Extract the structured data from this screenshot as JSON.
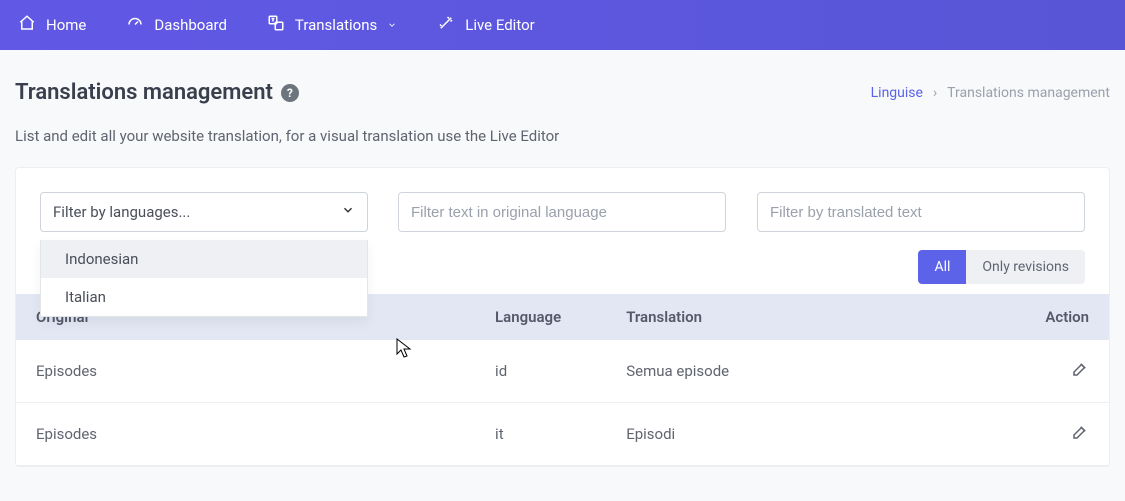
{
  "nav": {
    "home": "Home",
    "dashboard": "Dashboard",
    "translations": "Translations",
    "live_editor": "Live Editor"
  },
  "header": {
    "title": "Translations management",
    "breadcrumb_root": "Linguise",
    "breadcrumb_sep": "›",
    "breadcrumb_current": "Translations management"
  },
  "description": "List and edit all your website translation, for a visual translation use the Live Editor",
  "filters": {
    "language_placeholder": "Filter by languages...",
    "original_placeholder": "Filter text in original language",
    "translated_placeholder": "Filter by translated text",
    "options": [
      "Indonesian",
      "Italian"
    ]
  },
  "toggle": {
    "all": "All",
    "revisions": "Only revisions"
  },
  "table": {
    "headers": {
      "original": "Original",
      "language": "Language",
      "translation": "Translation",
      "action": "Action"
    },
    "rows": [
      {
        "original": "Episodes",
        "language": "id",
        "translation": "Semua episode"
      },
      {
        "original": "Episodes",
        "language": "it",
        "translation": "Episodi"
      }
    ]
  }
}
